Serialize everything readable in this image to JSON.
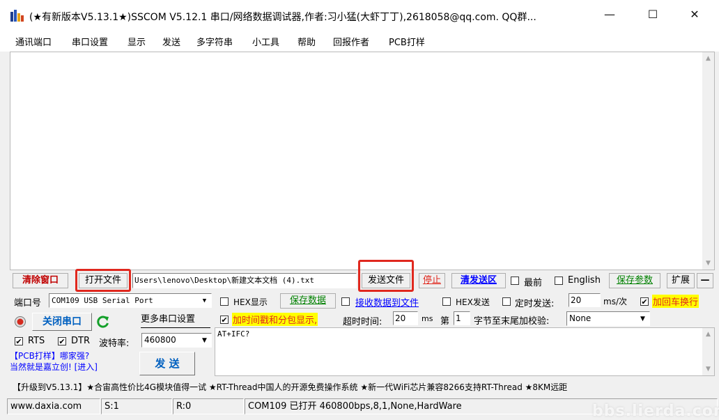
{
  "window": {
    "title": "(★有新版本V5.13.1★)SSCOM V5.12.1 串口/网络数据调试器,作者:习小猛(大虾丁丁),2618058@qq.com. QQ群...",
    "minimize_symbol": "—",
    "maximize_symbol": "☐",
    "close_symbol": "✕"
  },
  "menu": [
    "通讯端口",
    "串口设置",
    "显示",
    "发送",
    "多字符串",
    "小工具",
    "帮助",
    "回报作者",
    "PCB打样"
  ],
  "toolbar": {
    "clear_window": "清除窗口",
    "open_file": "打开文件",
    "file_path": "Users\\lenovo\\Desktop\\新建文本文档 (4).txt",
    "send_file": "发送文件",
    "stop": "停止",
    "clear_send_area": "清发送区",
    "topmost": "最前",
    "english": "English",
    "save_params": "保存参数",
    "expand": "扩展",
    "collapse": "—"
  },
  "port_panel": {
    "port_label": "端口号",
    "port_value": "COM109 USB Serial Port",
    "close_port": "关闭串口",
    "more_settings": "更多串口设置",
    "rts": "RTS",
    "dtr": "DTR",
    "baud_label": "波特率:",
    "baud_value": "460800",
    "pcb_line1": "【PCB打样】哪家强?",
    "pcb_line2": "当然就是嘉立创! [进入]",
    "send": "发 送"
  },
  "options_row1": {
    "hex_display": "HEX显示",
    "save_data": "保存数据",
    "recv_to_file": "接收数据到文件",
    "hex_send": "HEX发送",
    "timed_send": "定时发送:",
    "interval": "20",
    "interval_unit": "ms/次",
    "add_crlf": "加回车换行"
  },
  "options_row2": {
    "timestamp": "加时间戳和分包显示,",
    "timeout_label": "超时时间:",
    "timeout_value": "20",
    "timeout_unit": "ms",
    "byte_prefix": "第",
    "byte_value": "1",
    "checksum_label": "字节至末尾加校验:",
    "checksum_value": "None"
  },
  "send_text": "AT+IFC?",
  "ticker": "【升级到V5.13.1】★合宙高性价比4G模块值得一试 ★RT-Thread中国人的开源免费操作系统 ★新一代WiFi芯片兼容8266支持RT-Thread ★8KM远距",
  "status": {
    "website": "www.daxia.com",
    "s_count": "S:1",
    "r_count": "R:0",
    "port_status": "COM109 已打开  460800bps,8,1,None,HardWare"
  },
  "watermark": "bbs.lierda.com",
  "colors": {
    "highlight_red": "#e0281e",
    "link_blue": "#0000ff",
    "link_green": "#008000",
    "highlight_yellow": "#ffff00",
    "clear_window_red": "#c00000"
  }
}
